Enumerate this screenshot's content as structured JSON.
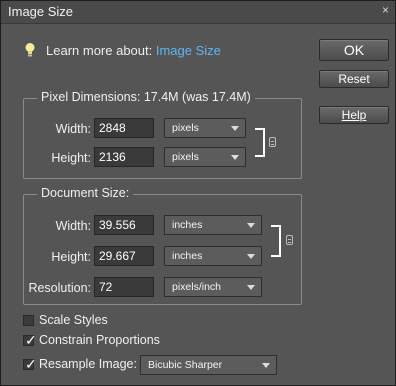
{
  "dialog": {
    "title": "Image Size",
    "close_glyph": "×",
    "learn_prefix": "Learn more about:",
    "learn_link": "Image Size"
  },
  "buttons": {
    "ok": "OK",
    "reset": "Reset",
    "help": "Help"
  },
  "pixel_dimensions": {
    "legend": "Pixel Dimensions:",
    "size": "17.4M (was 17.4M)",
    "width_label": "Width:",
    "width_value": "2848",
    "width_unit": "pixels",
    "height_label": "Height:",
    "height_value": "2136",
    "height_unit": "pixels"
  },
  "document_size": {
    "legend": "Document Size:",
    "width_label": "Width:",
    "width_value": "39.556",
    "width_unit": "inches",
    "height_label": "Height:",
    "height_value": "29.667",
    "height_unit": "inches",
    "resolution_label": "Resolution:",
    "resolution_value": "72",
    "resolution_unit": "pixels/inch"
  },
  "options": {
    "scale_styles": "Scale Styles",
    "scale_styles_checked": false,
    "constrain": "Constrain Proportions",
    "constrain_checked": true,
    "resample": "Resample Image:",
    "resample_checked": true,
    "resample_method": "Bicubic Sharper"
  },
  "icons": {
    "bulb": "lightbulb-icon",
    "link": "chain-link-icon",
    "dropdown": "chevron-down-icon"
  },
  "colors": {
    "dialog_bg": "#555555",
    "link": "#5fb7f2",
    "text": "#f0f0f0"
  }
}
